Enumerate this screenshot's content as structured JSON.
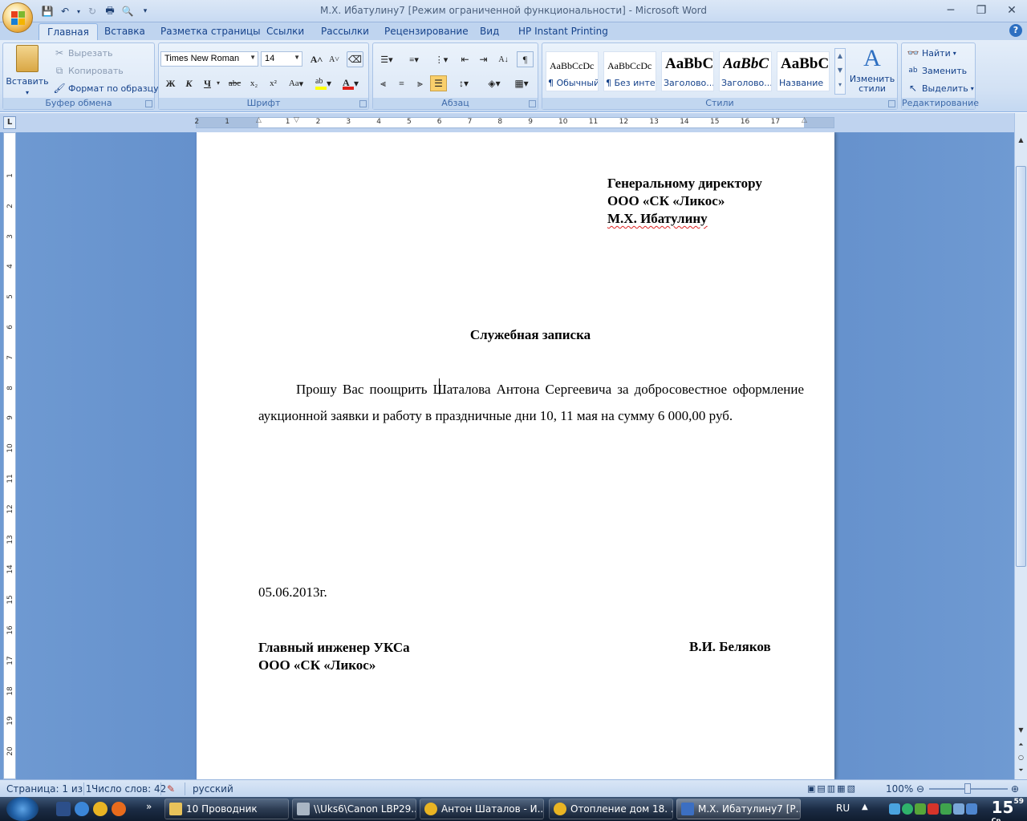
{
  "window": {
    "title": "М.Х. Ибатулину7 [Режим ограниченной функциональности] - Microsoft Word"
  },
  "tabs": [
    {
      "label": "Главная"
    },
    {
      "label": "Вставка"
    },
    {
      "label": "Разметка страницы"
    },
    {
      "label": "Ссылки"
    },
    {
      "label": "Рассылки"
    },
    {
      "label": "Рецензирование"
    },
    {
      "label": "Вид"
    },
    {
      "label": "HP Instant Printing"
    }
  ],
  "ribbon": {
    "clipboard": {
      "label": "Буфер обмена",
      "paste": "Вставить",
      "cut": "Вырезать",
      "copy": "Копировать",
      "format_painter": "Формат по образцу"
    },
    "font": {
      "label": "Шрифт",
      "font_name": "Times New Roman",
      "font_size": "14",
      "bold": "Ж",
      "italic": "К",
      "underline": "Ч",
      "strike": "abc",
      "sub": "x₂",
      "sup": "x²",
      "case": "Aa",
      "grow": "A",
      "shrink": "A"
    },
    "paragraph": {
      "label": "Абзац"
    },
    "styles": {
      "label": "Стили",
      "items": [
        {
          "sample": "AaBbCcDc",
          "name": "¶ Обычный"
        },
        {
          "sample": "AaBbCcDc",
          "name": "¶ Без инте..."
        },
        {
          "sample": "AaBbC",
          "name": "Заголово..."
        },
        {
          "sample": "AaBbC",
          "name": "Заголово..."
        },
        {
          "sample": "AaBbC",
          "name": "Название"
        }
      ],
      "change": "Изменить стили"
    },
    "editing": {
      "label": "Редактирование",
      "find": "Найти",
      "replace": "Заменить",
      "select": "Выделить"
    }
  },
  "ruler": {
    "h_numbers": [
      "2",
      "1",
      "1",
      "2",
      "3",
      "4",
      "5",
      "6",
      "7",
      "8",
      "9",
      "10",
      "11",
      "12",
      "13",
      "14",
      "15",
      "16",
      "17"
    ],
    "v_numbers": [
      "1",
      "2",
      "3",
      "4",
      "5",
      "6",
      "7",
      "8",
      "9",
      "10",
      "11",
      "12",
      "13",
      "14",
      "15",
      "16",
      "17",
      "18",
      "19",
      "20"
    ]
  },
  "document": {
    "addressee": [
      "Генеральному директору",
      "ООО «СК «Ликос»",
      "М.Х. Ибатулину"
    ],
    "title": "Служебная записка",
    "body": "Прошу Вас поощрить Шаталова Антона Сергеевича за добросовестное оформление аукционной заявки и работу в праздничные дни 10, 11 мая на сумму 6 000,00 руб.",
    "date": "05.06.2013г.",
    "signer_position_line1": "Главный инженер УКСа",
    "signer_position_line2": "ООО «СК «Ликос»",
    "signer_name": "В.И. Беляков"
  },
  "statusbar": {
    "page": "Страница: 1 из 1",
    "words": "Число слов: 42",
    "language": "русский",
    "zoom": "100%"
  },
  "taskbar": {
    "items": [
      {
        "label": "10 Проводник"
      },
      {
        "label": "\\\\Uks6\\Canon LBP29..."
      },
      {
        "label": "Антон Шаталов - И..."
      },
      {
        "label": "Отопление дом 18. ..."
      },
      {
        "label": "М.Х. Ибатулину7 [Р..."
      }
    ],
    "lang": "RU",
    "time_hour": "15",
    "time_min": "59",
    "day": "Ср"
  }
}
